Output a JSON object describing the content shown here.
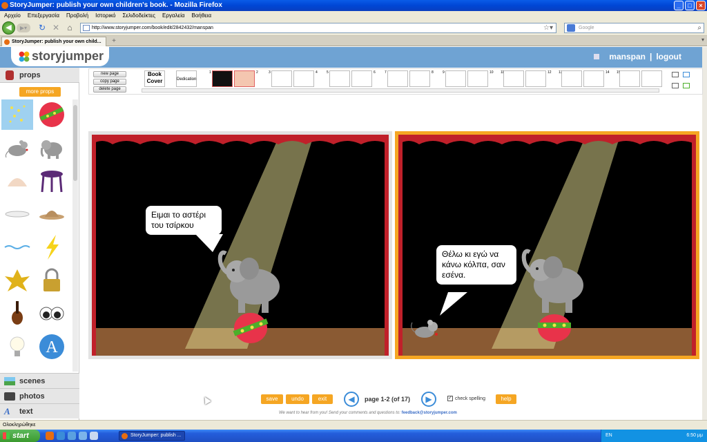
{
  "window": {
    "title": "StoryJumper: publish your own children's book. - Mozilla Firefox",
    "buttons": [
      "_",
      "□",
      "×"
    ]
  },
  "menu": [
    "Αρχείο",
    "Επεξεργασία",
    "Προβολή",
    "Ιστορικό",
    "Σελιδοδείκτες",
    "Εργαλεία",
    "Βοήθεια"
  ],
  "nav": {
    "url": "http://www.storyjumper.com/book/edit/2842432/manspan",
    "search_placeholder": "Google"
  },
  "tab": {
    "title": "StoryJumper: publish your own child..."
  },
  "site": {
    "logo": "storyjumper",
    "user": "manspan",
    "separator": "|",
    "logout": "logout"
  },
  "sidebar": {
    "props_label": "props",
    "more_props": "more props",
    "props": [
      "stars",
      "ball",
      "mouse",
      "elephant",
      "hat-top",
      "stool",
      "plate",
      "hat",
      "water",
      "lightning",
      "leaf",
      "padlock",
      "violin",
      "eyes",
      "lightbulb",
      "text-letter"
    ],
    "categories": [
      "scenes",
      "photos",
      "text"
    ]
  },
  "toolbar": {
    "new_page": "new page",
    "copy_page": "copy page",
    "delete_page": "delete page",
    "book_cover": "Book Cover",
    "dedication": "Dedication",
    "page_numbers": [
      "1",
      "2",
      "3",
      "4",
      "5",
      "6",
      "7",
      "8",
      "9",
      "10",
      "11",
      "12",
      "13",
      "14",
      "15"
    ]
  },
  "pages": {
    "left": {
      "speech": "Ειμαι το αστέρι του τσίρκου"
    },
    "right": {
      "speech": "Θέλω κι εγώ να κάνω κόλπα, σαν εσένα."
    }
  },
  "bottom": {
    "save": "save",
    "undo": "undo",
    "exit": "exit",
    "page_indicator": "page 1-2 (of 17)",
    "check_spelling": "check spelling",
    "check_spelling_checked": "✓",
    "help": "help",
    "feedback_text": "We want to hear from you! Send your comments and questions to:",
    "feedback_email": "feedback@storyjumper.com"
  },
  "statusbar": {
    "text": "Ολοκληρώθηκε"
  },
  "taskbar": {
    "start": "start",
    "task": "StoryJumper: publish ...",
    "lang": "EN",
    "clock": "6:50 μμ"
  },
  "colors": {
    "accent": "#f5a623",
    "header": "#6fa3d3",
    "curtain": "#c0202a",
    "floor": "#8a5a33"
  }
}
